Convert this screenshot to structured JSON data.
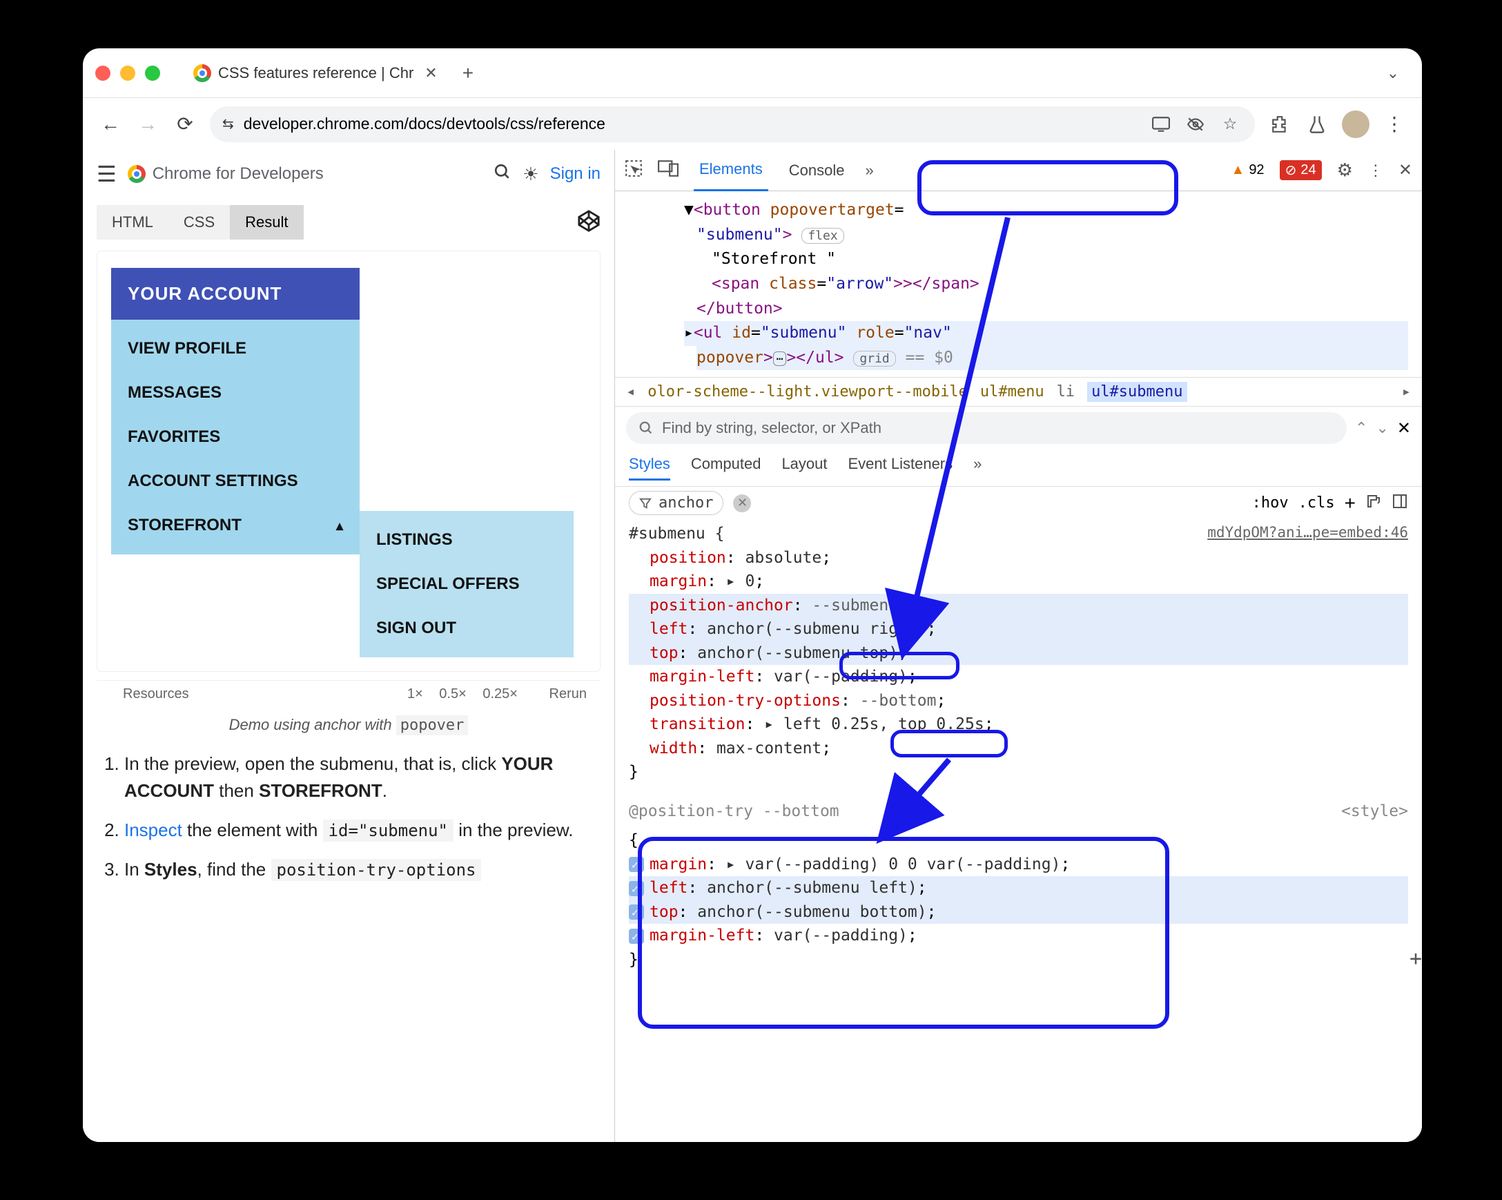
{
  "browser": {
    "tab_title": "CSS features reference | Chr",
    "url_display": "developer.chrome.com/docs/devtools/css/reference",
    "url_domain": "developer.chrome.com"
  },
  "page_header": {
    "brand": "Chrome for Developers",
    "signin": "Sign in"
  },
  "code_tabs": [
    "HTML",
    "CSS",
    "Result"
  ],
  "preview": {
    "menu_top": "YOUR ACCOUNT",
    "items": [
      "VIEW PROFILE",
      "MESSAGES",
      "FAVORITES",
      "ACCOUNT SETTINGS",
      "STOREFRONT"
    ],
    "submenu": [
      "LISTINGS",
      "SPECIAL OFFERS",
      "SIGN OUT"
    ],
    "footer_left": "Resources",
    "footer_scales": [
      "1×",
      "0.5×",
      "0.25×"
    ],
    "footer_rerun": "Rerun"
  },
  "caption_prefix": "Demo using anchor with ",
  "caption_code": "popover",
  "doc": {
    "li1_a": "In the preview, open the submenu, that is, click ",
    "li1_b1": "YOUR ACCOUNT",
    "li1_mid": " then ",
    "li1_b2": "STOREFRONT",
    "li2_link": "Inspect",
    "li2_a": " the element with ",
    "li2_code": "id=\"submenu\"",
    "li2_b": " in the preview.",
    "li3_a": "In ",
    "li3_b": "Styles",
    "li3_c": ", find the ",
    "li3_code": "position-try-options"
  },
  "devtools": {
    "tabs": [
      "Elements",
      "Console"
    ],
    "warn_count": "92",
    "err_count": "24",
    "dom": {
      "line1_a": "<button",
      "line1_b": "popovertarget",
      "line1_c": "=",
      "line2_a": "\"submenu\"",
      "line2_b": ">",
      "line2_badge": "flex",
      "line3": "\"Storefront \"",
      "line4_a": "<span",
      "line4_b": "class",
      "line4_c": "\"arrow\"",
      "line4_d": ">></span>",
      "line5": "</button>",
      "line6_a": "<ul",
      "line6_b": "id",
      "line6_c": "\"submenu\"",
      "line6_d": "role",
      "line6_e": "\"nav\"",
      "line7_a": "popover",
      "line7_b": "></ul>",
      "line7_badge": "grid",
      "line7_tail": " == $0"
    },
    "breadcrumb": [
      "olor-scheme--light.viewport--mobile",
      "ul#menu",
      "li",
      "ul#submenu"
    ],
    "search_placeholder": "Find by string, selector, or XPath",
    "styles_tabs": [
      "Styles",
      "Computed",
      "Layout",
      "Event Listeners"
    ],
    "filter_value": "anchor",
    "hov": ":hov",
    "cls": ".cls",
    "css": {
      "selector": "#submenu {",
      "source": "mdYdpOM?ani…pe=embed:46",
      "rules": [
        {
          "prop": "position",
          "val": "absolute"
        },
        {
          "prop": "margin",
          "val": "▸ 0"
        },
        {
          "prop": "position-anchor",
          "val": "--submenu",
          "isvar": true,
          "hl": true,
          "callout": "pa"
        },
        {
          "prop": "left",
          "val": "anchor(--submenu right)",
          "hl": true
        },
        {
          "prop": "top",
          "val": "anchor(--submenu top)",
          "hl": true
        },
        {
          "prop": "margin-left",
          "val": "var(--padding)"
        },
        {
          "prop": "position-try-options",
          "val": "--bottom",
          "isvar": true,
          "callout": "pto"
        },
        {
          "prop": "transition",
          "val": "▸ left 0.25s, top 0.25s"
        },
        {
          "prop": "width",
          "val": "max-content"
        }
      ],
      "posttry_header": "@position-try --bottom",
      "posttry_source": "<style>",
      "posttry_rules": [
        {
          "prop": "margin",
          "val": "▸ var(--padding) 0 0 var(--padding)"
        },
        {
          "prop": "left",
          "val": "anchor(--submenu left)",
          "hl": true
        },
        {
          "prop": "top",
          "val": "anchor(--submenu bottom)",
          "hl": true
        },
        {
          "prop": "margin-left",
          "val": "var(--padding)"
        }
      ]
    }
  }
}
